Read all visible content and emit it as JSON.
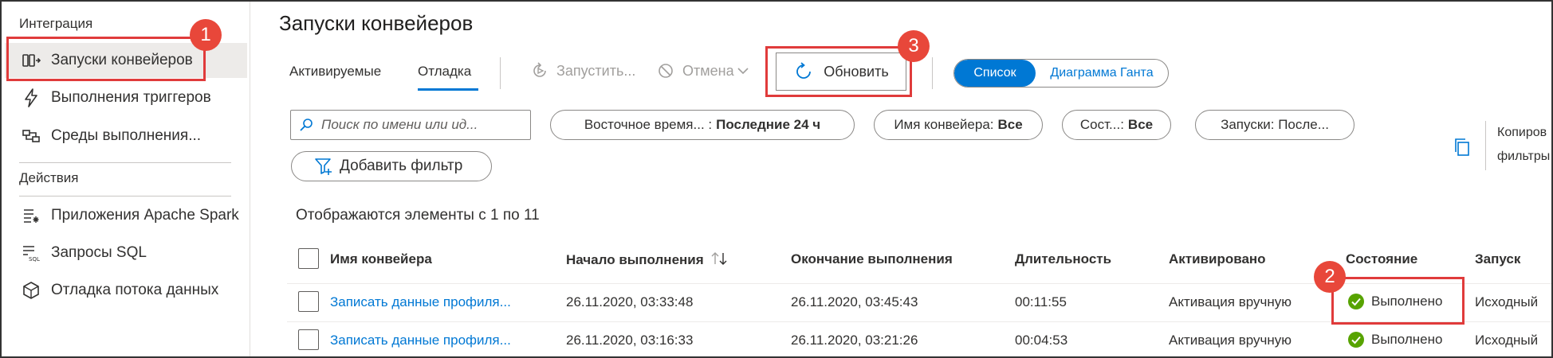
{
  "sidebar": {
    "section_integration": "Интеграция",
    "section_actions": "Действия",
    "items": [
      {
        "label": "Запуски конвейеров",
        "icon": "pipeline-runs-icon"
      },
      {
        "label": "Выполнения триггеров",
        "icon": "trigger-icon"
      },
      {
        "label": "Среды выполнения...",
        "icon": "integration-runtime-icon"
      },
      {
        "label": "Приложения Apache Spark",
        "icon": "spark-apps-icon"
      },
      {
        "label": "Запросы SQL",
        "icon": "sql-requests-icon"
      },
      {
        "label": "Отладка потока данных",
        "icon": "dataflow-debug-icon"
      }
    ]
  },
  "header": {
    "title": "Запуски конвейеров"
  },
  "tabs": [
    {
      "label": "Активируемые"
    },
    {
      "label": "Отладка",
      "active": true
    }
  ],
  "toolbar": {
    "run_label": "Запустить...",
    "cancel_label": "Отмена",
    "refresh_label": "Обновить",
    "view_list": "Список",
    "view_gantt": "Диаграмма Ганта"
  },
  "filters": {
    "search_placeholder": "Поиск по имени или ид...",
    "time_label": "Восточное время... :",
    "time_value": "Последние 24 ч",
    "pipeline_label": "Имя конвейера:",
    "pipeline_value": "Все",
    "status_label": "Сост...:",
    "status_value": "Все",
    "runs_label": "Запуски: После...",
    "add_filter": "Добавить фильтр",
    "copy_line1": "Копиров",
    "copy_line2": "фильтры"
  },
  "table": {
    "count_text": "Отображаются элементы с 1 по 11",
    "headers": {
      "name": "Имя конвейера",
      "start": "Начало выполнения",
      "end": "Окончание выполнения",
      "duration": "Длительность",
      "triggered": "Активировано",
      "status": "Состояние",
      "run": "Запуск"
    },
    "rows": [
      {
        "name": "Записать данные профиля...",
        "start": "26.11.2020, 03:33:48",
        "end": "26.11.2020, 03:45:43",
        "duration": "00:11:55",
        "triggered": "Активация вручную",
        "status": "Выполнено",
        "run": "Исходный"
      },
      {
        "name": "Записать данные профиля...",
        "start": "26.11.2020, 03:16:33",
        "end": "26.11.2020, 03:21:26",
        "duration": "00:04:53",
        "triggered": "Активация вручную",
        "status": "Выполнено",
        "run": "Исходный"
      }
    ]
  },
  "annotations": {
    "m1": "1",
    "m2": "2",
    "m3": "3"
  },
  "colors": {
    "accent": "#0078d4",
    "success": "#57a300",
    "highlight": "#e03b3b"
  }
}
